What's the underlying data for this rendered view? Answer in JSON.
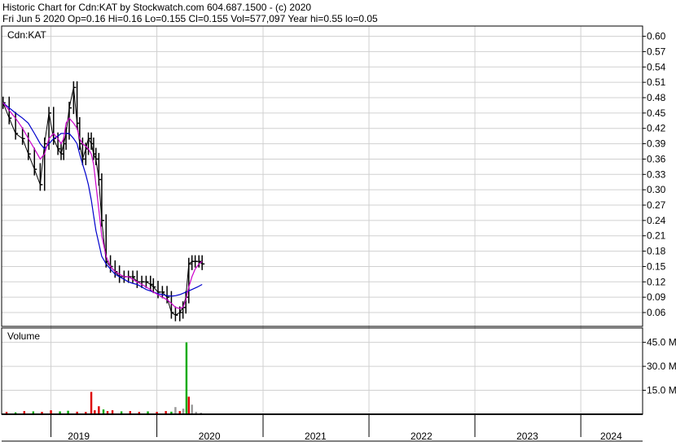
{
  "header": {
    "line1": "Historic Chart for Cdn:KAT by Stockwatch.com 604.687.1500 - (c) 2020",
    "line2": "Fri Jun  5 2020  Op=0.16  Hi=0.16  Lo=0.155  Cl=0.155  Vol=577,097  Year hi=0.55  lo=0.05"
  },
  "colors": {
    "background": "#ffffff",
    "grid": "#d0d0d0",
    "frame": "#000000",
    "price_bars": "#000000",
    "ma_short": "#cc00cc",
    "ma_long": "#0000cc",
    "vol_up": "#00aa00",
    "vol_down": "#dd0000",
    "vol_neutral": "#999999"
  },
  "chart_data": [
    {
      "type": "line",
      "title": "Cdn:KAT",
      "x_axis": {
        "labels": [
          "2019",
          "2020",
          "2021",
          "2022",
          "2023",
          "2024"
        ],
        "range": [
          "2018-07-15",
          "2024-08-01"
        ]
      },
      "y_axis": {
        "ticks": [
          "0.60",
          "0.57",
          "0.54",
          "0.51",
          "0.48",
          "0.45",
          "0.42",
          "0.39",
          "0.36",
          "0.33",
          "0.30",
          "0.27",
          "0.24",
          "0.21",
          "0.18",
          "0.15",
          "0.12",
          "0.09",
          "0.06"
        ],
        "range": [
          0.033,
          0.62
        ]
      },
      "grid": true,
      "price_series": {
        "x": [
          "2018-07-20",
          "2018-08-10",
          "2018-09-01",
          "2018-09-25",
          "2018-10-15",
          "2018-11-05",
          "2018-11-25",
          "2018-12-10",
          "2018-12-25",
          "2019-01-10",
          "2019-01-25",
          "2019-02-05",
          "2019-02-14",
          "2019-02-22",
          "2019-03-05",
          "2019-03-20",
          "2019-04-01",
          "2019-04-10",
          "2019-04-20",
          "2019-05-01",
          "2019-05-10",
          "2019-05-20",
          "2019-05-28",
          "2019-06-05",
          "2019-06-15",
          "2019-06-25",
          "2019-07-10",
          "2019-07-25",
          "2019-08-10",
          "2019-08-25",
          "2019-09-10",
          "2019-09-25",
          "2019-10-10",
          "2019-10-25",
          "2019-11-10",
          "2019-11-25",
          "2019-12-10",
          "2019-12-20",
          "2020-01-05",
          "2020-01-20",
          "2020-02-05",
          "2020-02-20",
          "2020-03-05",
          "2020-03-20",
          "2020-03-31",
          "2020-04-10",
          "2020-04-20",
          "2020-05-01",
          "2020-05-12",
          "2020-05-25",
          "2020-06-05"
        ],
        "close": [
          0.47,
          0.44,
          0.41,
          0.4,
          0.37,
          0.34,
          0.31,
          0.39,
          0.45,
          0.4,
          0.38,
          0.37,
          0.39,
          0.41,
          0.46,
          0.5,
          0.43,
          0.39,
          0.36,
          0.38,
          0.4,
          0.39,
          0.37,
          0.36,
          0.32,
          0.24,
          0.16,
          0.15,
          0.14,
          0.13,
          0.13,
          0.13,
          0.13,
          0.12,
          0.12,
          0.12,
          0.115,
          0.11,
          0.1,
          0.1,
          0.09,
          0.06,
          0.055,
          0.06,
          0.07,
          0.09,
          0.155,
          0.16,
          0.16,
          0.16,
          0.155
        ]
      },
      "ma_short": [
        0.47,
        0.455,
        0.44,
        0.42,
        0.4,
        0.38,
        0.36,
        0.37,
        0.4,
        0.41,
        0.4,
        0.39,
        0.4,
        0.43,
        0.44,
        0.43,
        0.42,
        0.4,
        0.39,
        0.385,
        0.38,
        0.37,
        0.35,
        0.31,
        0.26,
        0.21,
        0.17,
        0.15,
        0.14,
        0.135,
        0.13,
        0.13,
        0.125,
        0.12,
        0.115,
        0.11,
        0.105,
        0.1,
        0.095,
        0.09,
        0.085,
        0.078,
        0.07,
        0.068,
        0.07,
        0.085,
        0.11,
        0.13,
        0.145,
        0.155,
        0.16
      ],
      "ma_long": [
        0.47,
        0.46,
        0.45,
        0.44,
        0.43,
        0.41,
        0.39,
        0.38,
        0.39,
        0.4,
        0.405,
        0.41,
        0.41,
        0.41,
        0.41,
        0.4,
        0.39,
        0.37,
        0.35,
        0.33,
        0.31,
        0.28,
        0.25,
        0.22,
        0.195,
        0.17,
        0.155,
        0.145,
        0.135,
        0.13,
        0.125,
        0.12,
        0.117,
        0.115,
        0.11,
        0.105,
        0.102,
        0.1,
        0.097,
        0.095,
        0.093,
        0.092,
        0.093,
        0.095,
        0.1,
        0.105,
        0.11,
        0.115
      ],
      "ma_long_x": [
        "2018-07-20",
        "2018-08-10",
        "2018-09-01",
        "2018-09-25",
        "2018-10-15",
        "2018-11-05",
        "2018-11-25",
        "2018-12-10",
        "2018-12-25",
        "2019-01-10",
        "2019-01-25",
        "2019-02-05",
        "2019-02-14",
        "2019-02-22",
        "2019-03-05",
        "2019-03-20",
        "2019-04-01",
        "2019-04-10",
        "2019-04-20",
        "2019-05-01",
        "2019-05-10",
        "2019-05-20",
        "2019-05-28",
        "2019-06-05",
        "2019-06-15",
        "2019-06-25",
        "2019-07-10",
        "2019-07-25",
        "2019-08-10",
        "2019-08-25",
        "2019-09-10",
        "2019-09-25",
        "2019-10-10",
        "2019-10-25",
        "2019-11-10",
        "2019-11-25",
        "2019-12-10",
        "2019-12-20",
        "2020-01-05",
        "2020-01-20",
        "2020-02-05",
        "2020-02-20",
        "2020-03-05",
        "2020-03-20",
        "2020-04-10",
        "2020-05-01",
        "2020-05-20",
        "2020-06-05"
      ]
    },
    {
      "type": "bar",
      "title": "Volume",
      "y_axis": {
        "ticks": [
          "45.0 M",
          "30.0 M",
          "15.0 M"
        ],
        "range": [
          0,
          54
        ]
      },
      "grid": true,
      "volume_series": {
        "x": [
          "2018-08-01",
          "2018-09-01",
          "2018-10-01",
          "2018-11-01",
          "2018-12-01",
          "2019-01-01",
          "2019-02-01",
          "2019-03-01",
          "2019-04-01",
          "2019-05-01",
          "2019-05-20",
          "2019-06-01",
          "2019-06-15",
          "2019-07-01",
          "2019-07-15",
          "2019-08-01",
          "2019-09-01",
          "2019-10-01",
          "2019-11-01",
          "2019-12-01",
          "2020-01-01",
          "2020-02-01",
          "2020-02-20",
          "2020-03-05",
          "2020-03-20",
          "2020-04-01",
          "2020-04-12",
          "2020-04-20",
          "2020-05-01",
          "2020-05-15",
          "2020-06-01"
        ],
        "values": [
          1.5,
          1.2,
          2.0,
          1.8,
          1.5,
          2.5,
          1.8,
          2.2,
          1.6,
          1.5,
          14.0,
          2.5,
          5.0,
          3.0,
          2.0,
          2.5,
          1.8,
          2.0,
          1.5,
          1.8,
          1.5,
          2.0,
          1.6,
          4.5,
          2.0,
          3.5,
          45.0,
          11.0,
          6.0,
          1.5,
          1.0
        ],
        "direction": [
          "down",
          "up",
          "down",
          "up",
          "down",
          "down",
          "up",
          "up",
          "down",
          "down",
          "down",
          "down",
          "down",
          "up",
          "down",
          "down",
          "up",
          "down",
          "down",
          "up",
          "down",
          "down",
          "up",
          "neutral",
          "down",
          "neutral",
          "up",
          "down",
          "neutral",
          "neutral",
          "neutral"
        ]
      }
    }
  ]
}
